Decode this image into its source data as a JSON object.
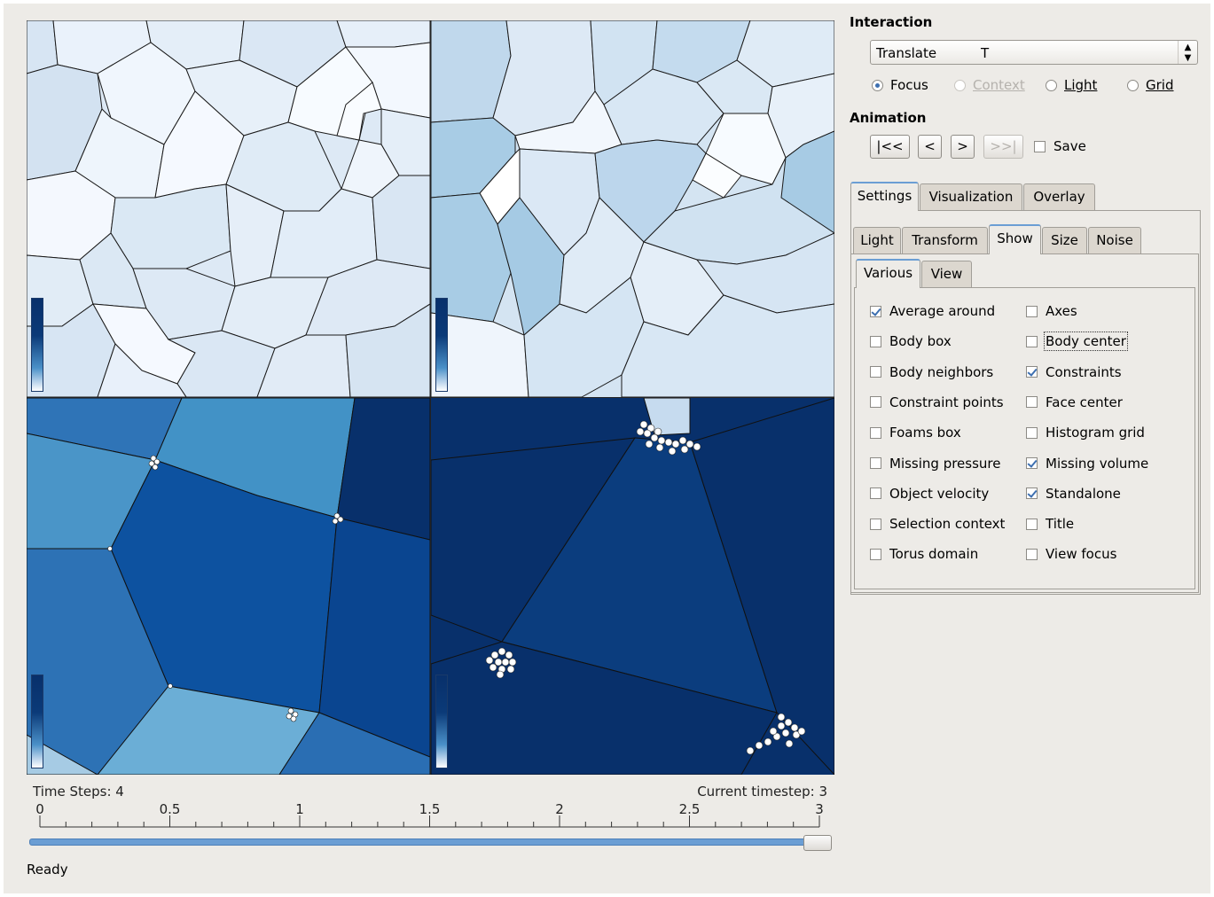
{
  "interaction": {
    "title": "Interaction",
    "mode_value": "Translate",
    "mode_shortcut": "T",
    "radios": [
      {
        "label": "Focus",
        "checked": true,
        "enabled": true
      },
      {
        "label": "Context",
        "checked": false,
        "enabled": false
      },
      {
        "label": "Light",
        "checked": false,
        "enabled": true
      },
      {
        "label": "Grid",
        "checked": false,
        "enabled": true
      }
    ]
  },
  "animation": {
    "title": "Animation",
    "buttons": [
      "|<<",
      "<",
      ">",
      ">>|"
    ],
    "save_label": "Save",
    "save_checked": false
  },
  "tabs": {
    "main": [
      "Settings",
      "Visualization",
      "Overlay"
    ],
    "main_active": "Settings",
    "sub": [
      "Light",
      "Transform",
      "Show",
      "Size",
      "Noise"
    ],
    "sub_active": "Show",
    "inner": [
      "Various",
      "View"
    ],
    "inner_active": "Various"
  },
  "show_options": {
    "left": [
      {
        "label": "Average around",
        "checked": true
      },
      {
        "label": "Body box",
        "checked": false
      },
      {
        "label": "Body neighbors",
        "checked": false
      },
      {
        "label": "Constraint points",
        "checked": false
      },
      {
        "label": "Foams box",
        "checked": false
      },
      {
        "label": "Missing pressure",
        "checked": false
      },
      {
        "label": "Object velocity",
        "checked": false
      },
      {
        "label": "Selection context",
        "checked": false
      },
      {
        "label": "Torus domain",
        "checked": false
      }
    ],
    "right": [
      {
        "label": "Axes",
        "checked": false
      },
      {
        "label": "Body center",
        "checked": false
      },
      {
        "label": "Constraints",
        "checked": true
      },
      {
        "label": "Face center",
        "checked": false
      },
      {
        "label": "Histogram grid",
        "checked": false
      },
      {
        "label": "Missing volume",
        "checked": true
      },
      {
        "label": "Standalone",
        "checked": true
      },
      {
        "label": "Title",
        "checked": false
      },
      {
        "label": "View focus",
        "checked": false
      }
    ]
  },
  "timeline": {
    "time_steps_text": "Time Steps: 4",
    "current_timestep_text": "Current timestep: 3",
    "tick_labels": [
      "0",
      "0.5",
      "1",
      "1.5",
      "2",
      "2.5",
      "3"
    ],
    "current_value": 3,
    "max_value": 3
  },
  "status": "Ready",
  "colors": {
    "accent": "#6b9ed4",
    "dark_blue": "#08306b",
    "light_blue": "#deebf7"
  }
}
